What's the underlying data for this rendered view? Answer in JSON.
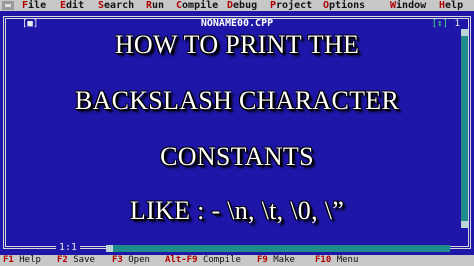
{
  "menubar": {
    "items": [
      "File",
      "Edit",
      "Search",
      "Run",
      "Compile",
      "Debug",
      "Project",
      "Options",
      "Window",
      "Help"
    ]
  },
  "window": {
    "title": "NONAME00.CPP",
    "close_box": "[■]",
    "zoom_box": "[↕]",
    "number": "1",
    "cursor_position": "1:1"
  },
  "overlay": {
    "lines": [
      "HOW TO PRINT THE",
      "BACKSLASH CHARACTER",
      "CONSTANTS",
      "LIKE : - \\n, \\t, \\0, \\”"
    ]
  },
  "statusbar": {
    "entries": [
      {
        "key": "F1",
        "label": "Help"
      },
      {
        "key": "F2",
        "label": "Save"
      },
      {
        "key": "F3",
        "label": "Open"
      },
      {
        "key": "Alt-F9",
        "label": "Compile"
      },
      {
        "key": "F9",
        "label": "Make"
      },
      {
        "key": "F10",
        "label": "Menu"
      }
    ]
  },
  "colors": {
    "editor_background": "#1d16a8",
    "menubar": "#c8c8c8",
    "hotkey": "#b00000",
    "scrollbar": "#1f8c8c"
  }
}
